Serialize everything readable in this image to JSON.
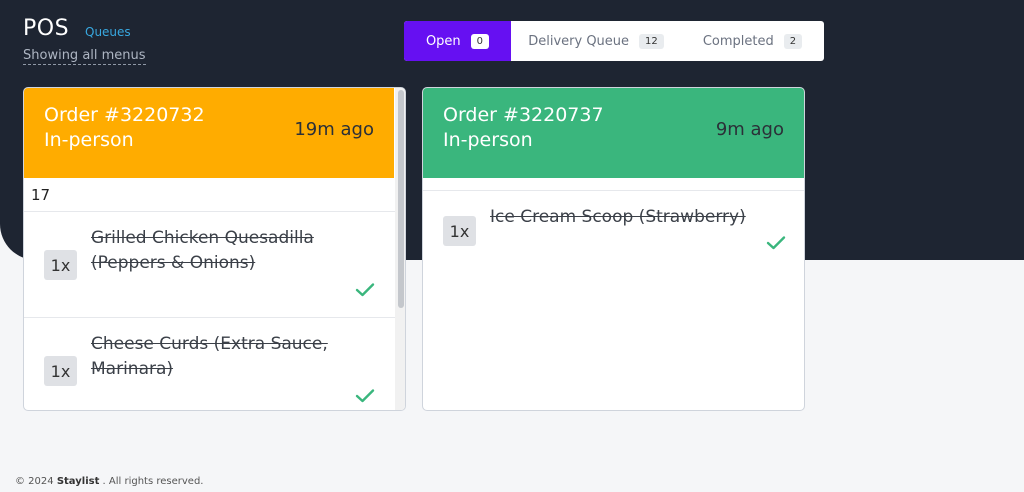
{
  "header": {
    "title": "POS",
    "queues_link": "Queues",
    "menu_filter": "Showing all menus"
  },
  "tabs": [
    {
      "label": "Open",
      "count": "0"
    },
    {
      "label": "Delivery Queue",
      "count": "12"
    },
    {
      "label": "Completed",
      "count": "2"
    }
  ],
  "orders": [
    {
      "number": "Order #3220732",
      "type": "In-person",
      "age": "19m ago",
      "status_color": "#ffac00",
      "note": "17",
      "items": [
        {
          "qty": "1x",
          "name": "Grilled Chicken Quesadilla (Peppers & Onions)"
        },
        {
          "qty": "1x",
          "name": "Cheese Curds (Extra Sauce, Marinara)"
        }
      ]
    },
    {
      "number": "Order #3220737",
      "type": "In-person",
      "age": "9m ago",
      "status_color": "#3ab67d",
      "items": [
        {
          "qty": "1x",
          "name": "Ice Cream Scoop (Strawberry)"
        }
      ]
    }
  ],
  "footer": {
    "prefix": "© 2024",
    "brand": "Staylist",
    "suffix": ". All rights reserved."
  },
  "colors": {
    "accent": "#6610f2",
    "header_bg": "#1e2532",
    "check": "#3ab67d",
    "link": "#38a8e0"
  }
}
